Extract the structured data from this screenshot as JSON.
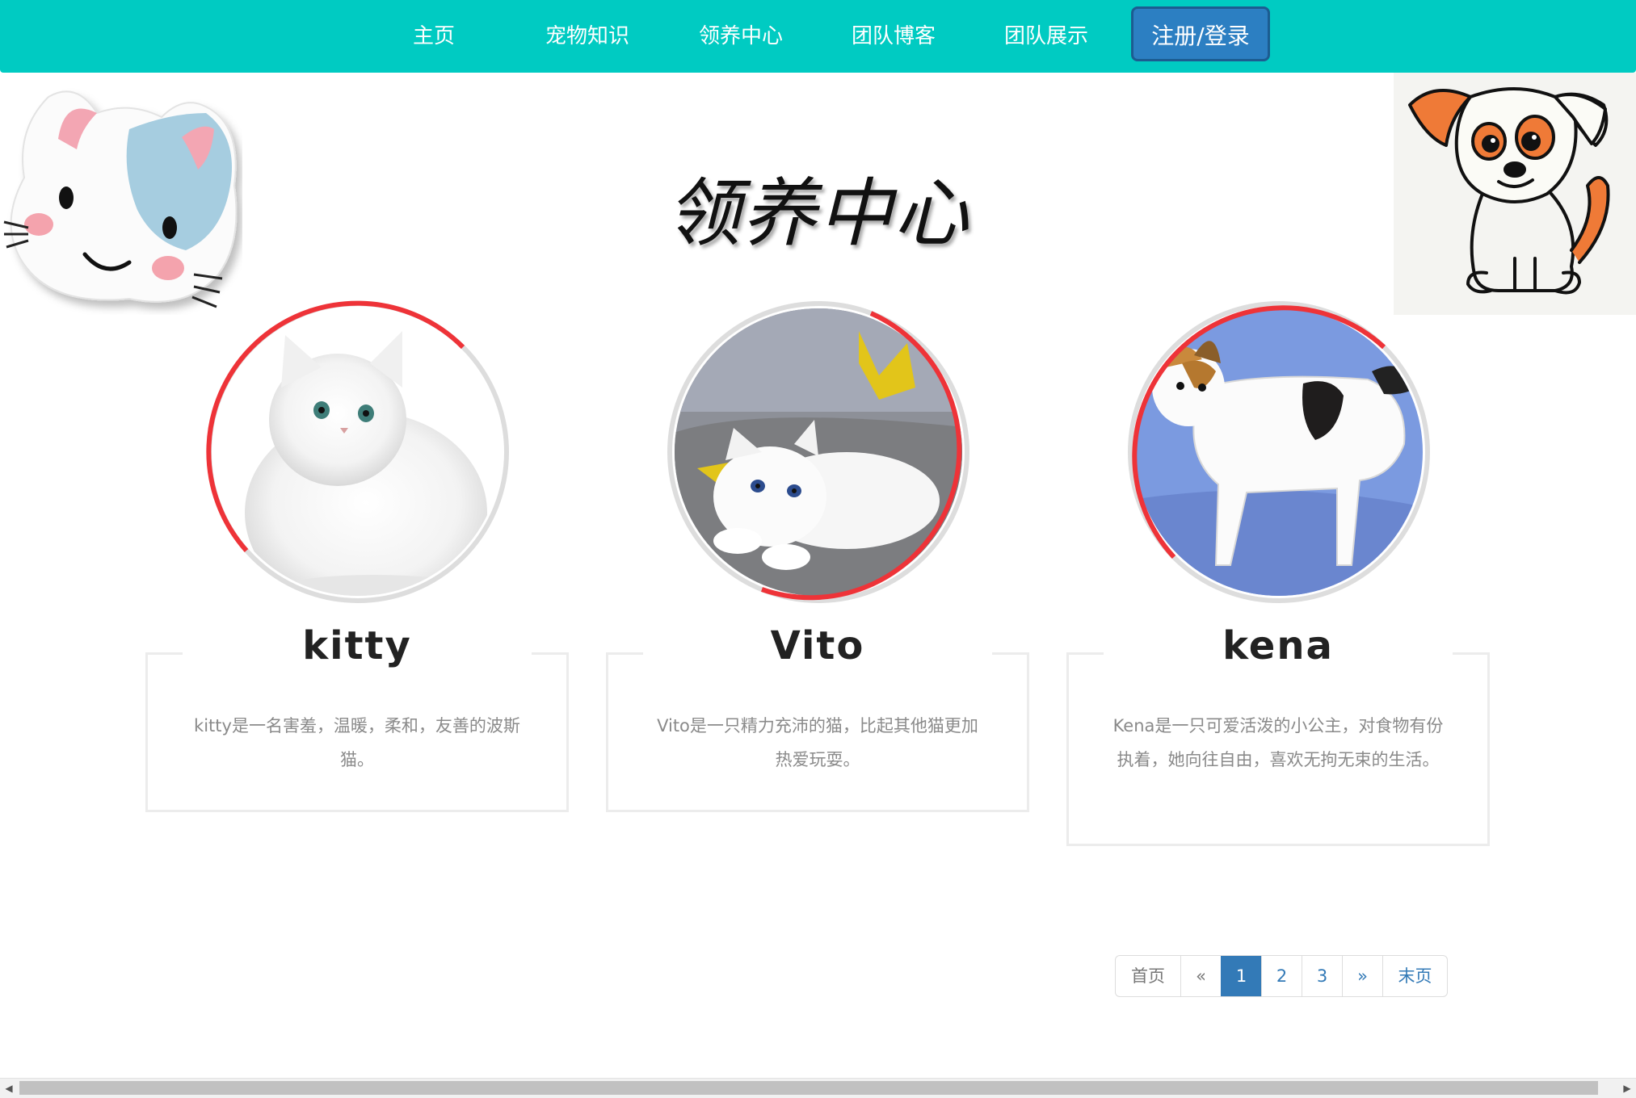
{
  "nav": {
    "items": [
      {
        "label": "主页"
      },
      {
        "label": "宠物知识"
      },
      {
        "label": "领养中心"
      },
      {
        "label": "团队博客"
      },
      {
        "label": "团队展示"
      }
    ],
    "login": "注册/登录"
  },
  "title": "领养中心",
  "pets": [
    {
      "name": "kitty",
      "desc": "kitty是一名害羞，温暖，柔和，友善的波斯猫。"
    },
    {
      "name": "Vito",
      "desc": "Vito是一只精力充沛的猫，比起其他猫更加热爱玩耍。"
    },
    {
      "name": "kena",
      "desc": "Kena是一只可爱活泼的小公主，对食物有份执着，她向往自由，喜欢无拘无束的生活。"
    }
  ],
  "pagination": {
    "first": "首页",
    "prev": "«",
    "pages": [
      "1",
      "2",
      "3"
    ],
    "next": "»",
    "last": "末页",
    "current": "1"
  },
  "colors": {
    "navbar": "#00cbc2",
    "login_button": "#2c7fc2",
    "ring_accent": "#ee3338",
    "pagination_active": "#337ab7"
  }
}
